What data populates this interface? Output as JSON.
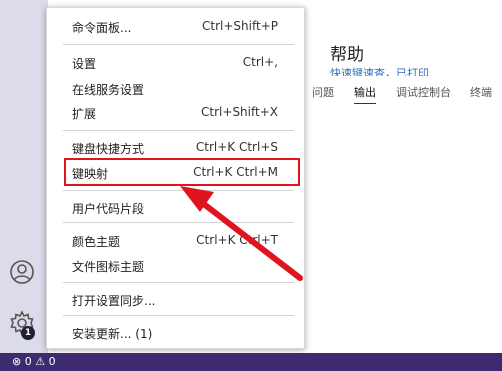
{
  "help": {
    "title": "帮助",
    "subtitle": "快速键速查，已打印"
  },
  "panel_tabs": [
    {
      "label": "问题"
    },
    {
      "label": "输出"
    },
    {
      "label": "调试控制台"
    },
    {
      "label": "终端"
    }
  ],
  "menu": {
    "items": [
      {
        "label": "命令面板...",
        "shortcut": "Ctrl+Shift+P"
      },
      {
        "label": "设置",
        "shortcut": "Ctrl+,"
      },
      {
        "label": "在线服务设置",
        "shortcut": ""
      },
      {
        "label": "扩展",
        "shortcut": "Ctrl+Shift+X"
      },
      {
        "label": "键盘快捷方式",
        "shortcut": "Ctrl+K Ctrl+S"
      },
      {
        "label": "键映射",
        "shortcut": "Ctrl+K Ctrl+M"
      },
      {
        "label": "用户代码片段",
        "shortcut": ""
      },
      {
        "label": "颜色主题",
        "shortcut": "Ctrl+K Ctrl+T"
      },
      {
        "label": "文件图标主题",
        "shortcut": ""
      },
      {
        "label": "打开设置同步...",
        "shortcut": ""
      },
      {
        "label": "安装更新... (1)",
        "shortcut": ""
      }
    ]
  },
  "activity_bar": {
    "icons": [
      "account-icon",
      "manage-gear-icon"
    ],
    "badge": "1"
  },
  "status_bar": {
    "problems": "⊗ 0 ⚠ 0"
  },
  "colors": {
    "status_bar": "#3e2b6f",
    "highlight": "#e0141e",
    "activity_bar": "#dcdbe9"
  }
}
